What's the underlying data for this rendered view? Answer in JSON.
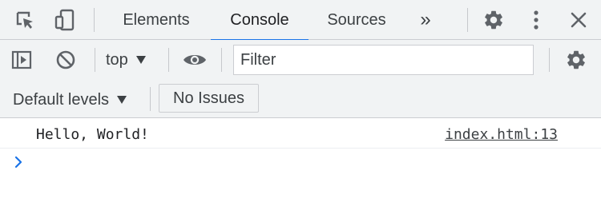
{
  "tabbar": {
    "inspect_icon": "inspect-element-icon",
    "device_icon": "device-toolbar-icon",
    "tabs": [
      {
        "label": "Elements",
        "active": false
      },
      {
        "label": "Console",
        "active": true
      },
      {
        "label": "Sources",
        "active": false
      }
    ],
    "more_tabs_label": "»",
    "settings_icon": "gear-icon",
    "menu_icon": "vertical-dots-icon",
    "close_icon": "close-icon"
  },
  "toolbar": {
    "sidebar_icon": "show-sidebar-icon",
    "clear_icon": "clear-console-icon",
    "context_value": "top",
    "live_expression_icon": "eye-icon",
    "filter_placeholder": "Filter",
    "filter_value": "",
    "settings_icon": "gear-icon",
    "levels_label": "Default levels",
    "issues_label": "No Issues"
  },
  "console": {
    "messages": [
      {
        "text": "Hello, World!",
        "source": "index.html:13"
      }
    ],
    "prompt_icon": "chevron-right-icon",
    "prompt_value": ""
  },
  "colors": {
    "toolbar_bg": "#f1f3f4",
    "active_tab_underline": "#1a73e8",
    "icon": "#5f6368",
    "prompt_chevron": "#1a73e8"
  }
}
